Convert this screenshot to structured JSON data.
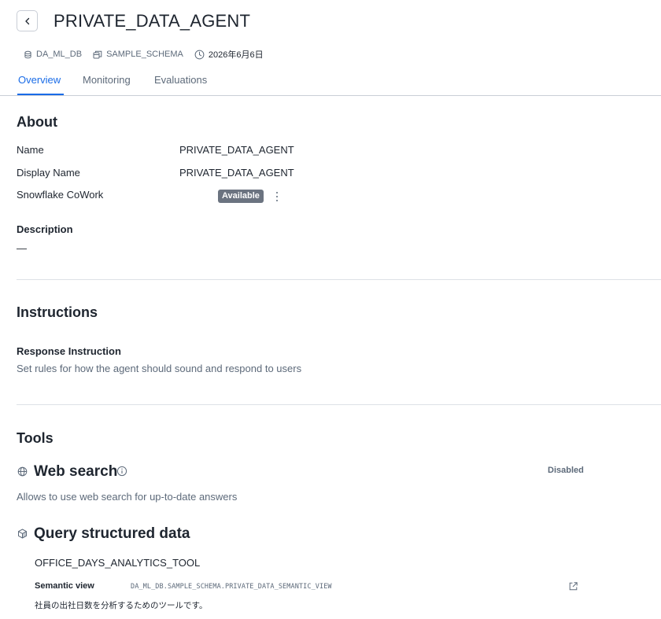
{
  "header": {
    "title": "PRIVATE_DATA_AGENT",
    "database": "DA_ML_DB",
    "schema": "SAMPLE_SCHEMA",
    "date": "2026年6月6日"
  },
  "tabs": [
    {
      "label": "Overview",
      "active": true
    },
    {
      "label": "Monitoring",
      "active": false
    },
    {
      "label": "Evaluations",
      "active": false
    }
  ],
  "about": {
    "heading": "About",
    "name_label": "Name",
    "name_value": "PRIVATE_DATA_AGENT",
    "display_name_label": "Display Name",
    "display_name_value": "PRIVATE_DATA_AGENT",
    "cowork_label": "Snowflake CoWork",
    "cowork_status": "Available",
    "description_label": "Description",
    "description_value": "—"
  },
  "instructions": {
    "heading": "Instructions",
    "response_label": "Response Instruction",
    "response_text": "Set rules for how the agent should sound and respond to users"
  },
  "tools": {
    "heading": "Tools",
    "web_search": {
      "title": "Web search",
      "status": "Disabled",
      "description": "Allows to use web search for up-to-date answers"
    },
    "structured": {
      "title": "Query structured data",
      "tool_name": "OFFICE_DAYS_ANALYTICS_TOOL",
      "semantic_label": "Semantic view",
      "semantic_value": "DA_ML_DB.SAMPLE_SCHEMA.PRIVATE_DATA_SEMANTIC_VIEW",
      "description": "社員の出社日数を分析するためのツールです。"
    }
  },
  "colors": {
    "accent": "#1a6ce7",
    "text": "#1e252f",
    "muted": "#5d6a7a",
    "badge_bg": "#6b7380",
    "divider": "#dde1e6"
  },
  "icons": {
    "back": "chevron-left-icon",
    "database": "database-icon",
    "schema": "schema-icon",
    "date": "clock-icon",
    "kebab": "kebab-menu-icon",
    "web": "globe-icon",
    "info": "info-icon",
    "cube": "cube-icon",
    "external": "external-link-icon"
  }
}
